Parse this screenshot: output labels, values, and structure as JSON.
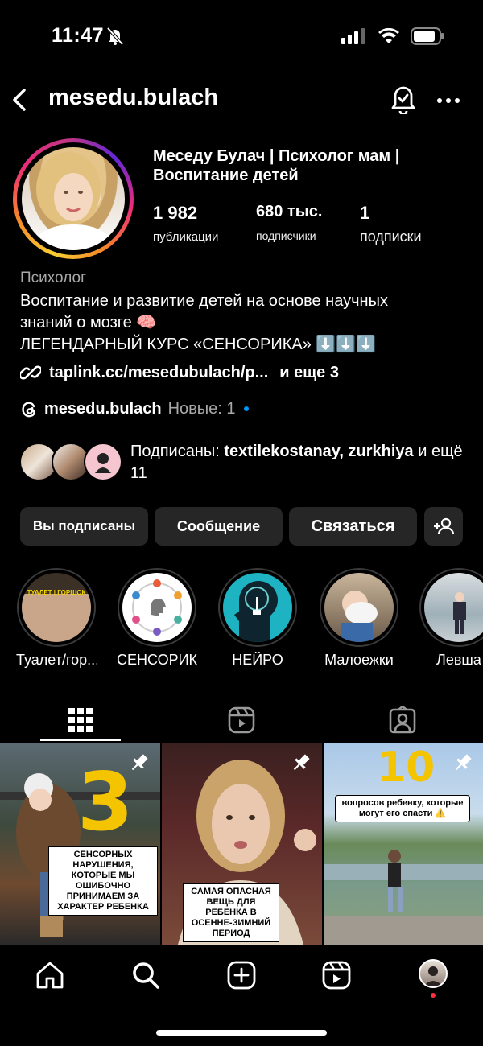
{
  "status_bar": {
    "time": "11:47"
  },
  "header": {
    "username": "mesedu.bulach"
  },
  "profile": {
    "full_name": "Меседу Булач |  Психолог мам  | Воспитание детей",
    "stats": [
      {
        "value": "1 982",
        "label": "публикации"
      },
      {
        "value": "680 тыс.",
        "label": "подписчики"
      },
      {
        "value": "1",
        "label": "подписки"
      }
    ],
    "category": "Психолог",
    "bio_line1": "Воспитание и развитие детей на основе научных",
    "bio_line2": "знаний о мозге 🧠",
    "bio_line3": "ЛЕГЕНДАРНЫЙ КУРС «СЕНСОРИКА» ⬇️⬇️⬇️",
    "link": "taplink.cc/mesedubulach/p...",
    "link_more": "и еще 3",
    "threads_handle": "mesedu.bulach",
    "threads_new": "Новые: 1",
    "followed_prefix": "Подписаны: ",
    "followed_names": "textilekostanay, zurkhiya",
    "followed_suffix": " и ещё 11"
  },
  "buttons": {
    "following": "Вы подписаны",
    "message": "Сообщение",
    "contact": "Связаться"
  },
  "highlights": [
    {
      "label": "Туалет/гор..."
    },
    {
      "label": "СЕНСОРИКА"
    },
    {
      "label": "НЕЙРО"
    },
    {
      "label": "Малоежки"
    },
    {
      "label": "Левша"
    }
  ],
  "highlight_text": {
    "toilet": "ТУАЛЕТ | ГОРШОК"
  },
  "posts": [
    {
      "number": "3",
      "caption": "СЕНСОРНЫХ НАРУШЕНИЯ, КОТОРЫЕ МЫ ОШИБОЧНО ПРИНИМАЕМ ЗА ХАРАКТЕР РЕБЕНКА",
      "pinned": true
    },
    {
      "caption": "САМАЯ ОПАСНАЯ ВЕЩЬ ДЛЯ РЕБЕНКА В ОСЕННЕ-ЗИМНИЙ ПЕРИОД",
      "pinned": true
    },
    {
      "number": "10",
      "caption": "вопросов ребенку, которые могут его спасти ⚠️",
      "pinned": true
    }
  ],
  "colors": {
    "accent_blue": "#0095f6",
    "button_bg": "#262626",
    "muted": "#a8a8a8",
    "notification_red": "#ff3040"
  }
}
